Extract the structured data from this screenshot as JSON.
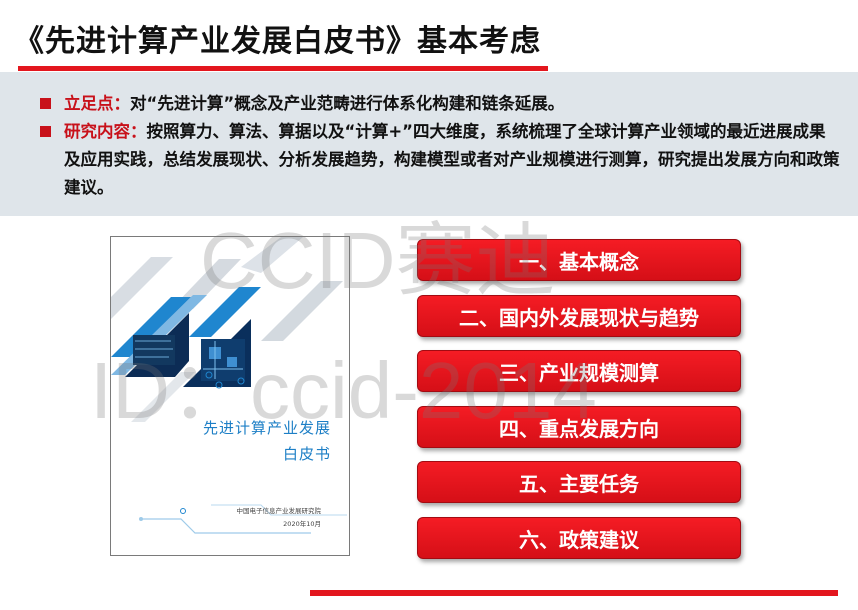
{
  "title": "《先进计算产业发展白皮书》基本考虑",
  "bullets": [
    {
      "key": "立足点：",
      "text": "对“先进计算”概念及产业范畴进行体系化构建和链条延展。"
    },
    {
      "key": "研究内容：",
      "text": "按照算力、算法、算据以及“计算+”四大维度，系统梳理了全球计算产业领域的最近进展成果及应用实践，总结发展现状、分析发展趋势，构建模型或者对产业规模进行测算，研究提出发展方向和政策建议。"
    }
  ],
  "cover": {
    "title_line1": "先进计算产业发展",
    "title_line2": "白皮书",
    "org": "中国电子信息产业发展研究院",
    "date": "2020年10月"
  },
  "watermark": {
    "line1": "CCID赛迪",
    "line2": "ID：ccid-2014"
  },
  "menu": [
    "一、基本概念",
    "二、国内外发展现状与趋势",
    "三、产业规模测算",
    "四、重点发展方向",
    "五、主要任务",
    "六、政策建议"
  ],
  "colors": {
    "accent": "#e3161e",
    "button": "#e8141c",
    "box": "#dfe5ea",
    "cover_blue": "#1d7fc6"
  }
}
